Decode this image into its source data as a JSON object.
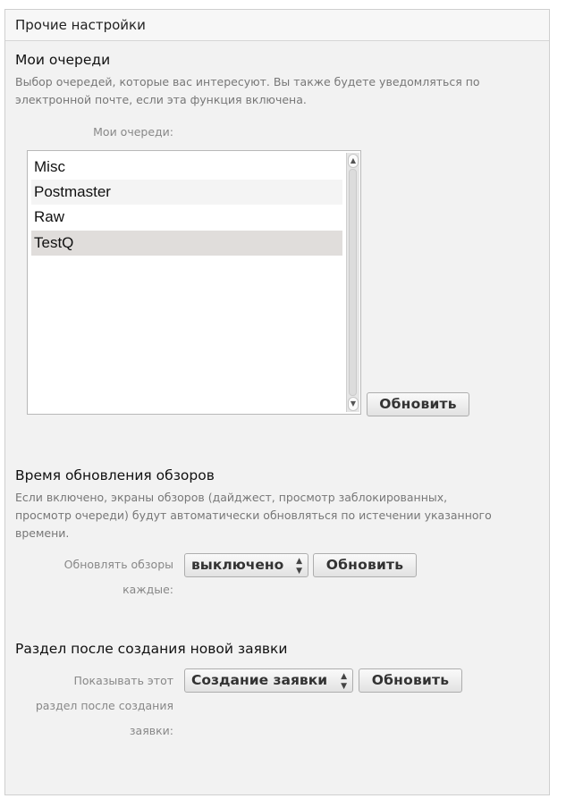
{
  "panel": {
    "title": "Прочие настройки"
  },
  "queues": {
    "title": "Мои очереди",
    "description_line1": "Выбор очередей, которые вас интересуют. Вы также будете уведомляться по",
    "description_line2": "электронной почте, если эта функция включена.",
    "field_label": "Мои очереди:",
    "items": [
      {
        "label": "Misc",
        "selected": false
      },
      {
        "label": "Postmaster",
        "selected": false
      },
      {
        "label": "Raw",
        "selected": false
      },
      {
        "label": "TestQ",
        "selected": true
      }
    ],
    "update_button": "Обновить"
  },
  "refresh": {
    "title": "Время обновления обзоров",
    "description_line1": "Если включено, экраны обзоров (дайджест, просмотр заблокированных,",
    "description_line2": "просмотр очереди) будут автоматически обновляться по истечении указанного",
    "description_line3": "времени.",
    "field_label_line1": "Обновлять обзоры",
    "field_label_line2": "каждые:",
    "select_value": "выключено",
    "update_button": "Обновить"
  },
  "after_create": {
    "title": "Раздел после создания новой заявки",
    "field_label_line1": "Показывать этот",
    "field_label_line2": "раздел после создания",
    "field_label_line3": "заявки:",
    "select_value": "Создание заявки",
    "update_button": "Обновить"
  },
  "icons": {
    "scroll_up": "scroll-up-arrow",
    "scroll_down": "scroll-down-arrow",
    "select_chevron": "up-down-chevron"
  }
}
